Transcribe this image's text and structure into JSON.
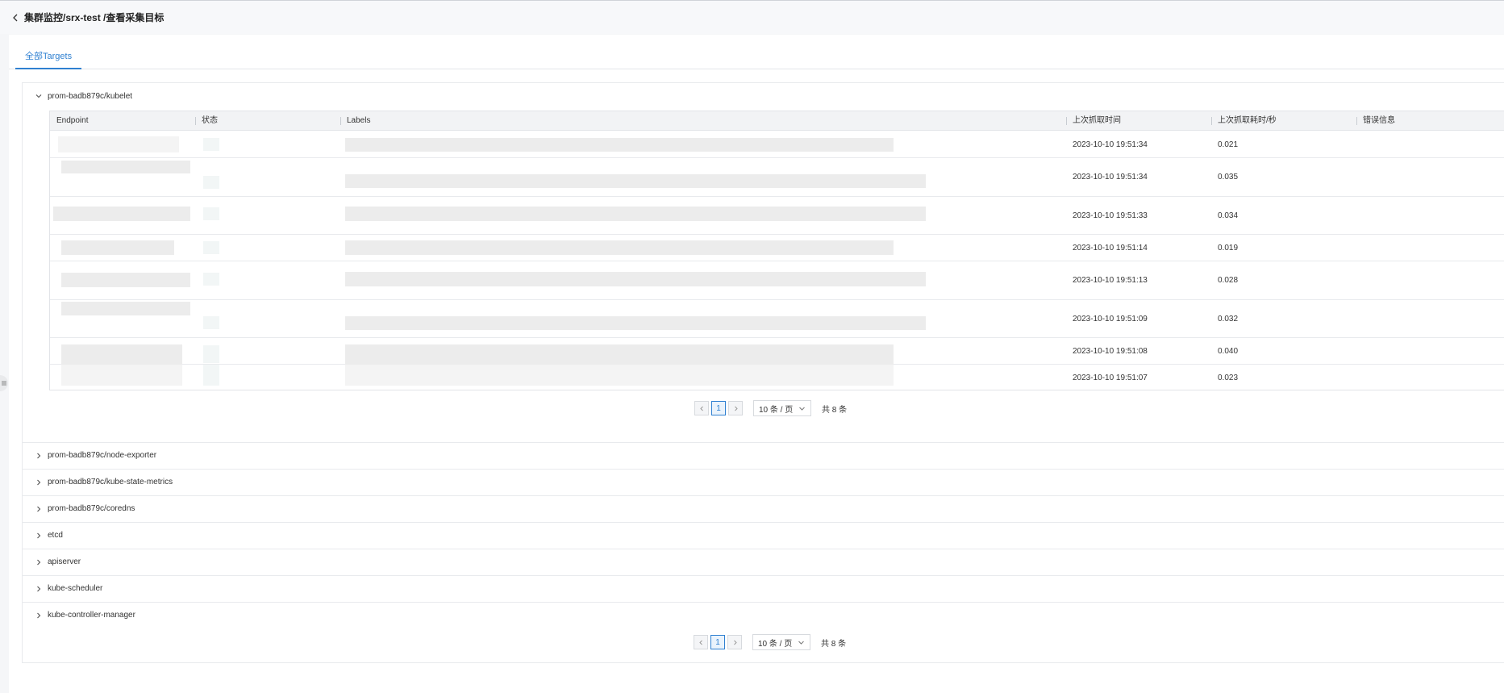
{
  "breadcrumb": "集群监控/srx-test /查看采集目标",
  "tabs": [
    {
      "label": "全部Targets"
    }
  ],
  "table": {
    "columns": [
      "Endpoint",
      "状态",
      "Labels",
      "上次抓取时间",
      "上次抓取耗时/秒",
      "错误信息"
    ],
    "rows": [
      {
        "last_scrape": "2023-10-10 19:51:34",
        "duration": "0.021",
        "error": ""
      },
      {
        "last_scrape": "2023-10-10 19:51:34",
        "duration": "0.035",
        "error": ""
      },
      {
        "last_scrape": "2023-10-10 19:51:33",
        "duration": "0.034",
        "error": ""
      },
      {
        "last_scrape": "2023-10-10 19:51:14",
        "duration": "0.019",
        "error": ""
      },
      {
        "last_scrape": "2023-10-10 19:51:13",
        "duration": "0.028",
        "error": ""
      },
      {
        "last_scrape": "2023-10-10 19:51:09",
        "duration": "0.032",
        "error": ""
      },
      {
        "last_scrape": "2023-10-10 19:51:08",
        "duration": "0.040",
        "error": ""
      },
      {
        "last_scrape": "2023-10-10 19:51:07",
        "duration": "0.023",
        "error": ""
      }
    ]
  },
  "groups": [
    {
      "name": "prom-badb879c/kubelet",
      "expanded": true
    },
    {
      "name": "prom-badb879c/node-exporter",
      "expanded": false
    },
    {
      "name": "prom-badb879c/kube-state-metrics",
      "expanded": false
    },
    {
      "name": "prom-badb879c/coredns",
      "expanded": false
    },
    {
      "name": "etcd",
      "expanded": false
    },
    {
      "name": "apiserver",
      "expanded": false
    },
    {
      "name": "kube-scheduler",
      "expanded": false
    },
    {
      "name": "kube-controller-manager",
      "expanded": false
    }
  ],
  "inner_pager": {
    "current_page": "1",
    "page_size": "10 条 / 页",
    "total": "共 8 条"
  },
  "outer_pager": {
    "current_page": "1",
    "page_size": "10 条 / 页",
    "total": "共 8 条"
  },
  "icons": {
    "back": "chevron-left-icon",
    "expanded": "chevron-down-icon",
    "collapsed": "chevron-right-icon",
    "prev": "chevron-left-icon",
    "next": "chevron-right-icon",
    "dropdown": "chevron-down-icon",
    "side_toggle": "menu-icon"
  },
  "colors": {
    "accent": "#2f80d1",
    "header_bg": "#f2f3f5",
    "border": "#e2e4e8"
  }
}
